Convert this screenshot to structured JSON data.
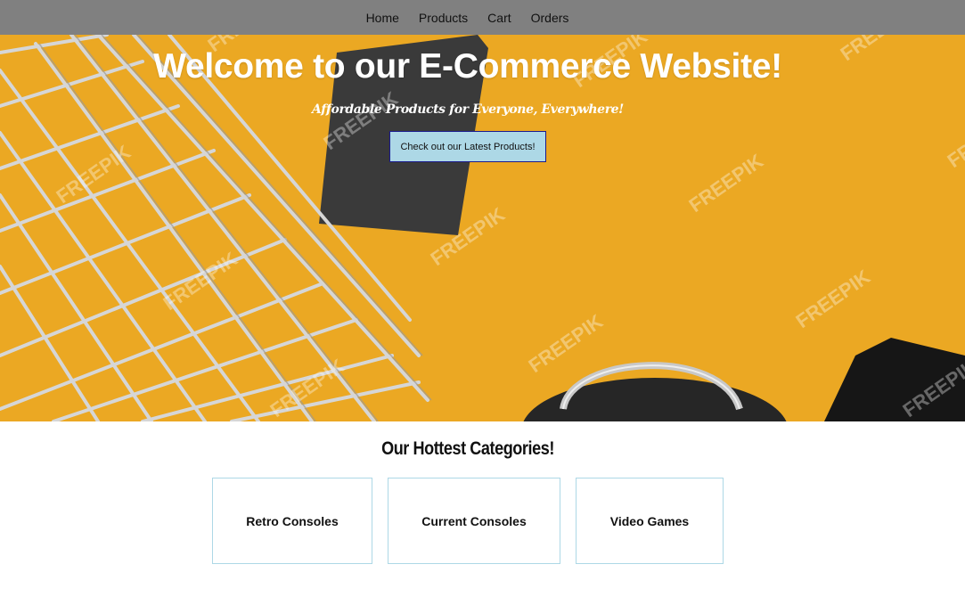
{
  "nav": {
    "items": [
      {
        "label": "Home"
      },
      {
        "label": "Products"
      },
      {
        "label": "Cart"
      },
      {
        "label": "Orders"
      }
    ]
  },
  "hero": {
    "title": "Welcome to our E-Commerce Website!",
    "subtitle": "Affordable Products for Everyone, Everywhere!",
    "button_label": "Check out our Latest Products!",
    "watermark": "FREEPIK"
  },
  "categories": {
    "heading": "Our Hottest Categories!",
    "items": [
      {
        "label": "Retro Consoles"
      },
      {
        "label": "Current Consoles"
      },
      {
        "label": "Video Games"
      }
    ]
  },
  "colors": {
    "navbar_bg": "#808080",
    "hero_bg": "#eba823",
    "button_bg": "#add8e6",
    "card_border": "#add8e6"
  }
}
